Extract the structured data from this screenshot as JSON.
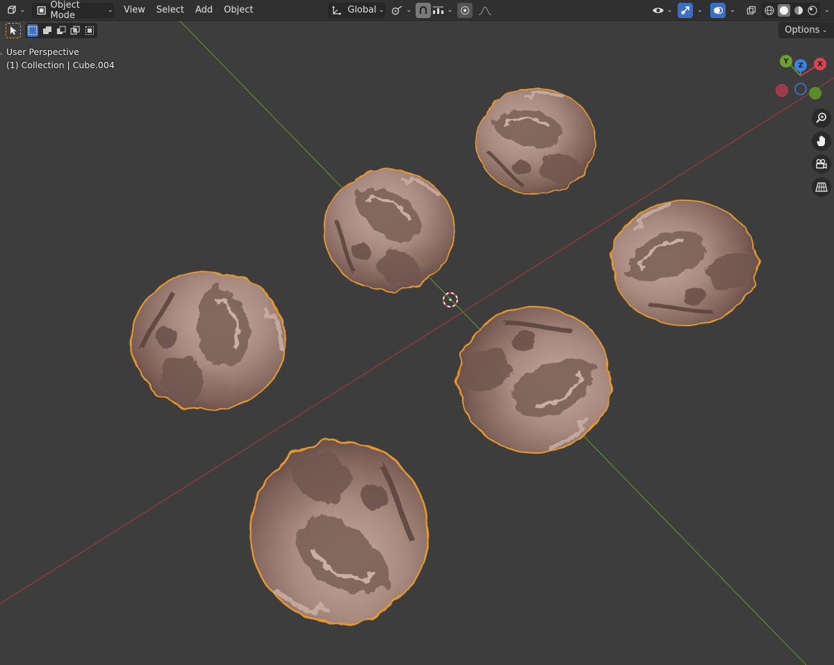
{
  "header": {
    "editor_type_icon": "view3d-icon",
    "mode_label": "Object Mode",
    "menus": [
      "View",
      "Select",
      "Add",
      "Object"
    ],
    "orientation_label": "Global",
    "icons": {
      "pivot": "pivot-transform-icon",
      "snap": "magnet-icon",
      "snap_target": "snap-increment-icon",
      "proportional": "proportional-edit-icon",
      "falloff": "falloff-curve-icon",
      "visibility": "eye-icon",
      "gizmo": "gizmo-arrow-icon",
      "overlay": "overlay-circles-icon",
      "xray": "xray-icon",
      "shading": [
        "wireframe-shading-icon",
        "solid-shading-icon",
        "material-shading-icon",
        "rendered-shading-icon"
      ]
    }
  },
  "toolrow": {
    "tool_icon": "select-cursor-icon",
    "select_modes": [
      "select-new-icon",
      "select-extend-icon",
      "select-subtract-icon",
      "select-invert-icon",
      "select-intersect-icon"
    ],
    "options_label": "Options"
  },
  "viewport": {
    "view_name": "User Perspective",
    "collection_info": "(1) Collection | Cube.004",
    "gizmo_axes": [
      "Y",
      "Z",
      "X"
    ]
  },
  "nav_icons": [
    "zoom-icon",
    "hand-pan-icon",
    "camera-icon",
    "grid-ortho-icon"
  ],
  "colors": {
    "background": "#3d3d3d",
    "header": "#303030",
    "x_axis": "#9a3b3b",
    "y_axis": "#5e8f26",
    "selection_outline": "#f0a030",
    "clay": "#a88a7e",
    "accent_blue": "#3d6ec5"
  }
}
